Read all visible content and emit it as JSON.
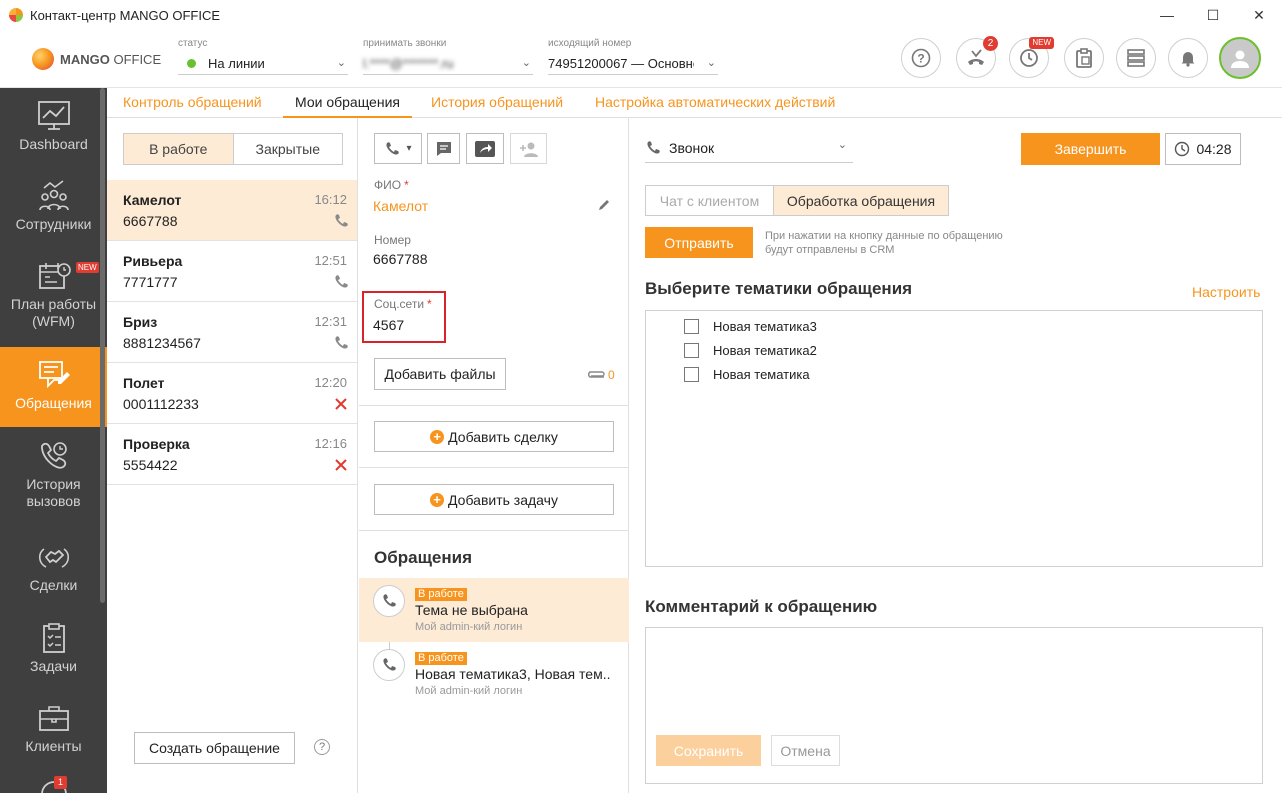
{
  "window": {
    "title": "Контакт-центр MANGO OFFICE",
    "minimize": "—",
    "maximize": "☐",
    "close": "✕"
  },
  "header": {
    "brand_bold": "MANGO",
    "brand_light": " OFFICE",
    "status": {
      "label": "статус",
      "value": "На линии"
    },
    "accept_calls": {
      "label": "принимать звонки",
      "value": "l.****@*******.ru"
    },
    "outgoing": {
      "label": "исходящий номер",
      "value": "74951200067 — Основнс"
    },
    "missed_calls_count": "2",
    "history_badge": "NEW"
  },
  "sidebar": {
    "items": [
      {
        "label": "Dashboard"
      },
      {
        "label": "Сотрудники"
      },
      {
        "label": "План работы (WFM)",
        "badge": "NEW"
      },
      {
        "label": "Обращения"
      },
      {
        "label": "История вызовов"
      },
      {
        "label": "Сделки"
      },
      {
        "label": "Задачи"
      },
      {
        "label": "Клиенты"
      }
    ],
    "bottom_badge": "1"
  },
  "tabs": [
    "Контроль обращений",
    "Мои обращения",
    "История обращений",
    "Настройка автоматических действий"
  ],
  "list": {
    "segment": [
      "В работе",
      "Закрытые"
    ],
    "items": [
      {
        "name": "Камелот",
        "phone": "6667788",
        "time": "16:12",
        "status": "phone"
      },
      {
        "name": "Ривьера",
        "phone": "7771777",
        "time": "12:51",
        "status": "phone"
      },
      {
        "name": "Бриз",
        "phone": "8881234567",
        "time": "12:31",
        "status": "phone"
      },
      {
        "name": "Полет",
        "phone": "0001112233",
        "time": "12:20",
        "status": "closed"
      },
      {
        "name": "Проверка",
        "phone": "5554422",
        "time": "12:16",
        "status": "closed"
      }
    ],
    "create_button": "Создать обращение",
    "help": "?"
  },
  "card": {
    "fio_label": "ФИО",
    "fio_value": "Камелот",
    "number_label": "Номер",
    "number_value": "6667788",
    "social_label": "Соц.сети",
    "social_value": "4567",
    "add_files": "Добавить файлы",
    "attachments_count": "0",
    "add_deal": "Добавить сделку",
    "add_task": "Добавить задачу",
    "requests_title": "Обращения",
    "timeline": [
      {
        "tag": "В работе",
        "title": "Тема не выбрана",
        "sub": "Мой admin-кий логин"
      },
      {
        "tag": "В работе",
        "title": "Новая тематика3, Новая тем...",
        "sub": "Мой admin-кий логин"
      }
    ]
  },
  "right": {
    "channel": "Звонок",
    "finish": "Завершить",
    "timer": "04:28",
    "tabs": [
      "Чат с клиентом",
      "Обработка обращения"
    ],
    "send": "Отправить",
    "send_hint": "При нажатии на кнопку данные по обращению будут отправлены в CRM",
    "topics_title": "Выберите тематики обращения",
    "configure": "Настроить",
    "topics": [
      "Новая тематика3",
      "Новая тематика2",
      "Новая тематика"
    ],
    "comment_title": "Комментарий к обращению",
    "save": "Сохранить",
    "cancel": "Отмена"
  },
  "colors": {
    "accent": "#f7941d",
    "sidebar": "#3f3f3f",
    "selected_row": "#fdebd6",
    "error": "#e03c31",
    "online": "#6cbf2d"
  }
}
